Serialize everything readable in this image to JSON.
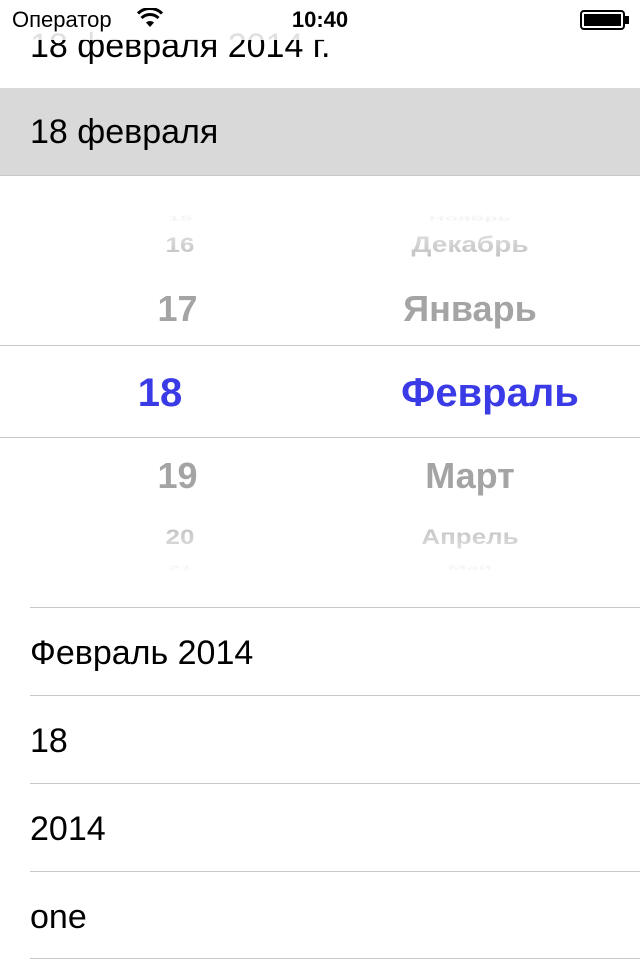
{
  "status_bar": {
    "carrier": "Оператор",
    "time": "10:40",
    "wifi_icon": "wifi-icon",
    "battery_icon": "battery-icon"
  },
  "rows": {
    "top_value": "18 февраля 2014 г.",
    "selected_value": "18 февраля"
  },
  "picker": {
    "days": [
      "15",
      "16",
      "17",
      "18",
      "19",
      "20",
      "21"
    ],
    "months": [
      "Ноябрь",
      "Декабрь",
      "Январь",
      "Февраль",
      "Март",
      "Апрель",
      "Май"
    ],
    "selected_day": "18",
    "selected_month": "Февраль",
    "selected_color": "#3a3ae6",
    "inactive_color": "#9a9a9a"
  },
  "list": [
    {
      "label": "Февраль 2014"
    },
    {
      "label": "18"
    },
    {
      "label": "2014"
    },
    {
      "label": "one"
    }
  ]
}
